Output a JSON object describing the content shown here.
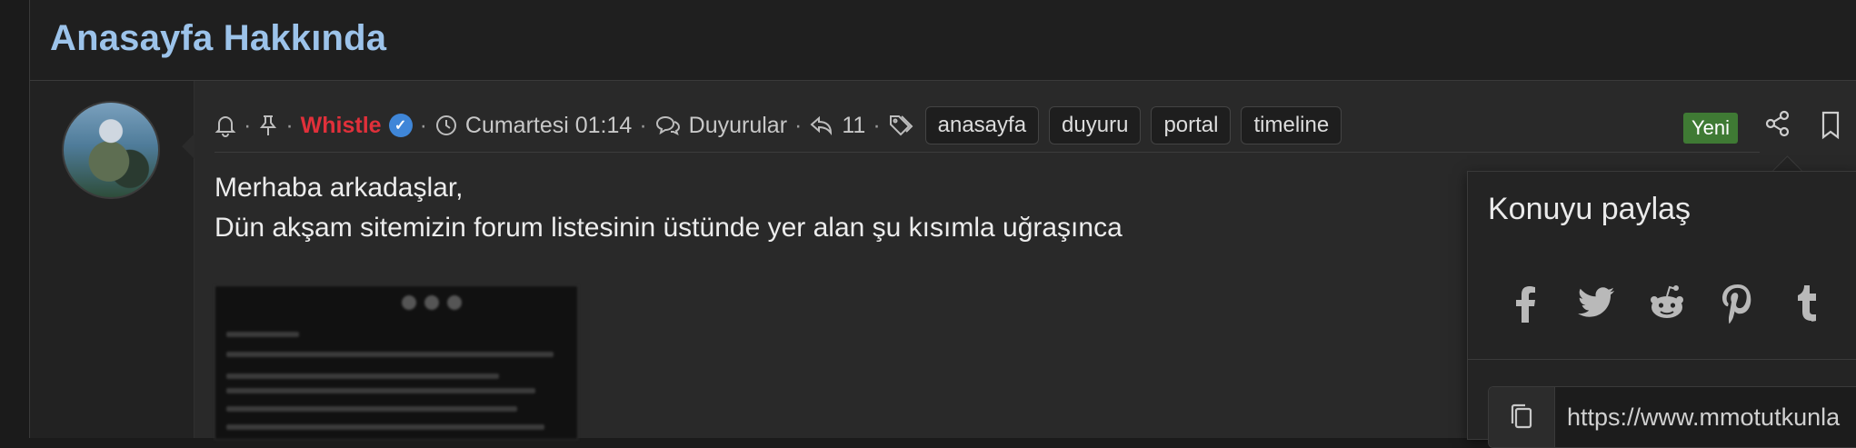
{
  "page": {
    "title": "Anasayfa Hakkında"
  },
  "post": {
    "author": "Whistle",
    "timestamp": "Cumartesi 01:14",
    "forum": "Duyurular",
    "reply_count": "11",
    "tags": [
      "anasayfa",
      "duyuru",
      "portal",
      "timeline"
    ],
    "new_badge": "Yeni",
    "body": [
      "Merhaba arkadaşlar,",
      "Dün akşam sitemizin forum listesinin üstünde yer alan şu kısımla uğraşınca"
    ]
  },
  "share_popup": {
    "title": "Konuyu paylaş",
    "networks": [
      "facebook-icon",
      "twitter-icon",
      "reddit-icon",
      "pinterest-icon",
      "tumblr-icon"
    ],
    "url": "https://www.mmotutkunla"
  },
  "colors": {
    "title": "#9cc3ea",
    "username": "#e0303a",
    "verified": "#3f86d8",
    "new_badge": "#3f7a34"
  }
}
